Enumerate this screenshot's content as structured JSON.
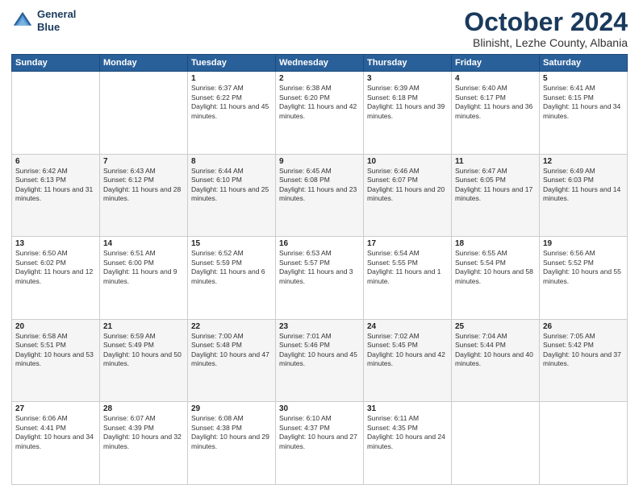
{
  "logo": {
    "line1": "General",
    "line2": "Blue"
  },
  "title": "October 2024",
  "subtitle": "Blinisht, Lezhe County, Albania",
  "days_header": [
    "Sunday",
    "Monday",
    "Tuesday",
    "Wednesday",
    "Thursday",
    "Friday",
    "Saturday"
  ],
  "weeks": [
    [
      {
        "day": "",
        "info": ""
      },
      {
        "day": "",
        "info": ""
      },
      {
        "day": "1",
        "info": "Sunrise: 6:37 AM\nSunset: 6:22 PM\nDaylight: 11 hours and 45 minutes."
      },
      {
        "day": "2",
        "info": "Sunrise: 6:38 AM\nSunset: 6:20 PM\nDaylight: 11 hours and 42 minutes."
      },
      {
        "day": "3",
        "info": "Sunrise: 6:39 AM\nSunset: 6:18 PM\nDaylight: 11 hours and 39 minutes."
      },
      {
        "day": "4",
        "info": "Sunrise: 6:40 AM\nSunset: 6:17 PM\nDaylight: 11 hours and 36 minutes."
      },
      {
        "day": "5",
        "info": "Sunrise: 6:41 AM\nSunset: 6:15 PM\nDaylight: 11 hours and 34 minutes."
      }
    ],
    [
      {
        "day": "6",
        "info": "Sunrise: 6:42 AM\nSunset: 6:13 PM\nDaylight: 11 hours and 31 minutes."
      },
      {
        "day": "7",
        "info": "Sunrise: 6:43 AM\nSunset: 6:12 PM\nDaylight: 11 hours and 28 minutes."
      },
      {
        "day": "8",
        "info": "Sunrise: 6:44 AM\nSunset: 6:10 PM\nDaylight: 11 hours and 25 minutes."
      },
      {
        "day": "9",
        "info": "Sunrise: 6:45 AM\nSunset: 6:08 PM\nDaylight: 11 hours and 23 minutes."
      },
      {
        "day": "10",
        "info": "Sunrise: 6:46 AM\nSunset: 6:07 PM\nDaylight: 11 hours and 20 minutes."
      },
      {
        "day": "11",
        "info": "Sunrise: 6:47 AM\nSunset: 6:05 PM\nDaylight: 11 hours and 17 minutes."
      },
      {
        "day": "12",
        "info": "Sunrise: 6:49 AM\nSunset: 6:03 PM\nDaylight: 11 hours and 14 minutes."
      }
    ],
    [
      {
        "day": "13",
        "info": "Sunrise: 6:50 AM\nSunset: 6:02 PM\nDaylight: 11 hours and 12 minutes."
      },
      {
        "day": "14",
        "info": "Sunrise: 6:51 AM\nSunset: 6:00 PM\nDaylight: 11 hours and 9 minutes."
      },
      {
        "day": "15",
        "info": "Sunrise: 6:52 AM\nSunset: 5:59 PM\nDaylight: 11 hours and 6 minutes."
      },
      {
        "day": "16",
        "info": "Sunrise: 6:53 AM\nSunset: 5:57 PM\nDaylight: 11 hours and 3 minutes."
      },
      {
        "day": "17",
        "info": "Sunrise: 6:54 AM\nSunset: 5:55 PM\nDaylight: 11 hours and 1 minute."
      },
      {
        "day": "18",
        "info": "Sunrise: 6:55 AM\nSunset: 5:54 PM\nDaylight: 10 hours and 58 minutes."
      },
      {
        "day": "19",
        "info": "Sunrise: 6:56 AM\nSunset: 5:52 PM\nDaylight: 10 hours and 55 minutes."
      }
    ],
    [
      {
        "day": "20",
        "info": "Sunrise: 6:58 AM\nSunset: 5:51 PM\nDaylight: 10 hours and 53 minutes."
      },
      {
        "day": "21",
        "info": "Sunrise: 6:59 AM\nSunset: 5:49 PM\nDaylight: 10 hours and 50 minutes."
      },
      {
        "day": "22",
        "info": "Sunrise: 7:00 AM\nSunset: 5:48 PM\nDaylight: 10 hours and 47 minutes."
      },
      {
        "day": "23",
        "info": "Sunrise: 7:01 AM\nSunset: 5:46 PM\nDaylight: 10 hours and 45 minutes."
      },
      {
        "day": "24",
        "info": "Sunrise: 7:02 AM\nSunset: 5:45 PM\nDaylight: 10 hours and 42 minutes."
      },
      {
        "day": "25",
        "info": "Sunrise: 7:04 AM\nSunset: 5:44 PM\nDaylight: 10 hours and 40 minutes."
      },
      {
        "day": "26",
        "info": "Sunrise: 7:05 AM\nSunset: 5:42 PM\nDaylight: 10 hours and 37 minutes."
      }
    ],
    [
      {
        "day": "27",
        "info": "Sunrise: 6:06 AM\nSunset: 4:41 PM\nDaylight: 10 hours and 34 minutes."
      },
      {
        "day": "28",
        "info": "Sunrise: 6:07 AM\nSunset: 4:39 PM\nDaylight: 10 hours and 32 minutes."
      },
      {
        "day": "29",
        "info": "Sunrise: 6:08 AM\nSunset: 4:38 PM\nDaylight: 10 hours and 29 minutes."
      },
      {
        "day": "30",
        "info": "Sunrise: 6:10 AM\nSunset: 4:37 PM\nDaylight: 10 hours and 27 minutes."
      },
      {
        "day": "31",
        "info": "Sunrise: 6:11 AM\nSunset: 4:35 PM\nDaylight: 10 hours and 24 minutes."
      },
      {
        "day": "",
        "info": ""
      },
      {
        "day": "",
        "info": ""
      }
    ]
  ]
}
